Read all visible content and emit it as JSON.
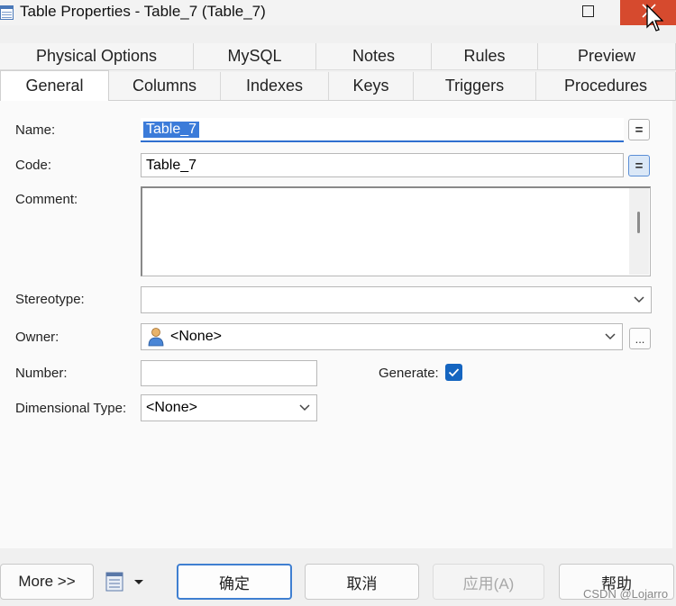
{
  "window": {
    "title": "Table Properties - Table_7 (Table_7)",
    "close_color": "#d64a2e"
  },
  "tabs": {
    "row1": [
      "Physical Options",
      "MySQL",
      "Notes",
      "Rules",
      "Preview"
    ],
    "row2": [
      "General",
      "Columns",
      "Indexes",
      "Keys",
      "Triggers",
      "Procedures"
    ],
    "active": "General"
  },
  "form": {
    "name_label": "Name:",
    "name_value": "Table_7",
    "code_label": "Code:",
    "code_value": "Table_7",
    "comment_label": "Comment:",
    "comment_value": "",
    "stereotype_label": "Stereotype:",
    "stereotype_value": "",
    "owner_label": "Owner:",
    "owner_value": "<None>",
    "owner_more": "...",
    "number_label": "Number:",
    "number_value": "",
    "generate_label": "Generate:",
    "generate_checked": true,
    "dimensional_label": "Dimensional Type:",
    "dimensional_value": "<None>",
    "eq_symbol": "="
  },
  "footer": {
    "more": "More >>",
    "ok": "确定",
    "cancel": "取消",
    "apply": "应用(A)",
    "help": "帮助"
  },
  "watermark": "CSDN @Lojarro",
  "colors": {
    "accent": "#1565c0",
    "selection": "#3b7bd9"
  }
}
